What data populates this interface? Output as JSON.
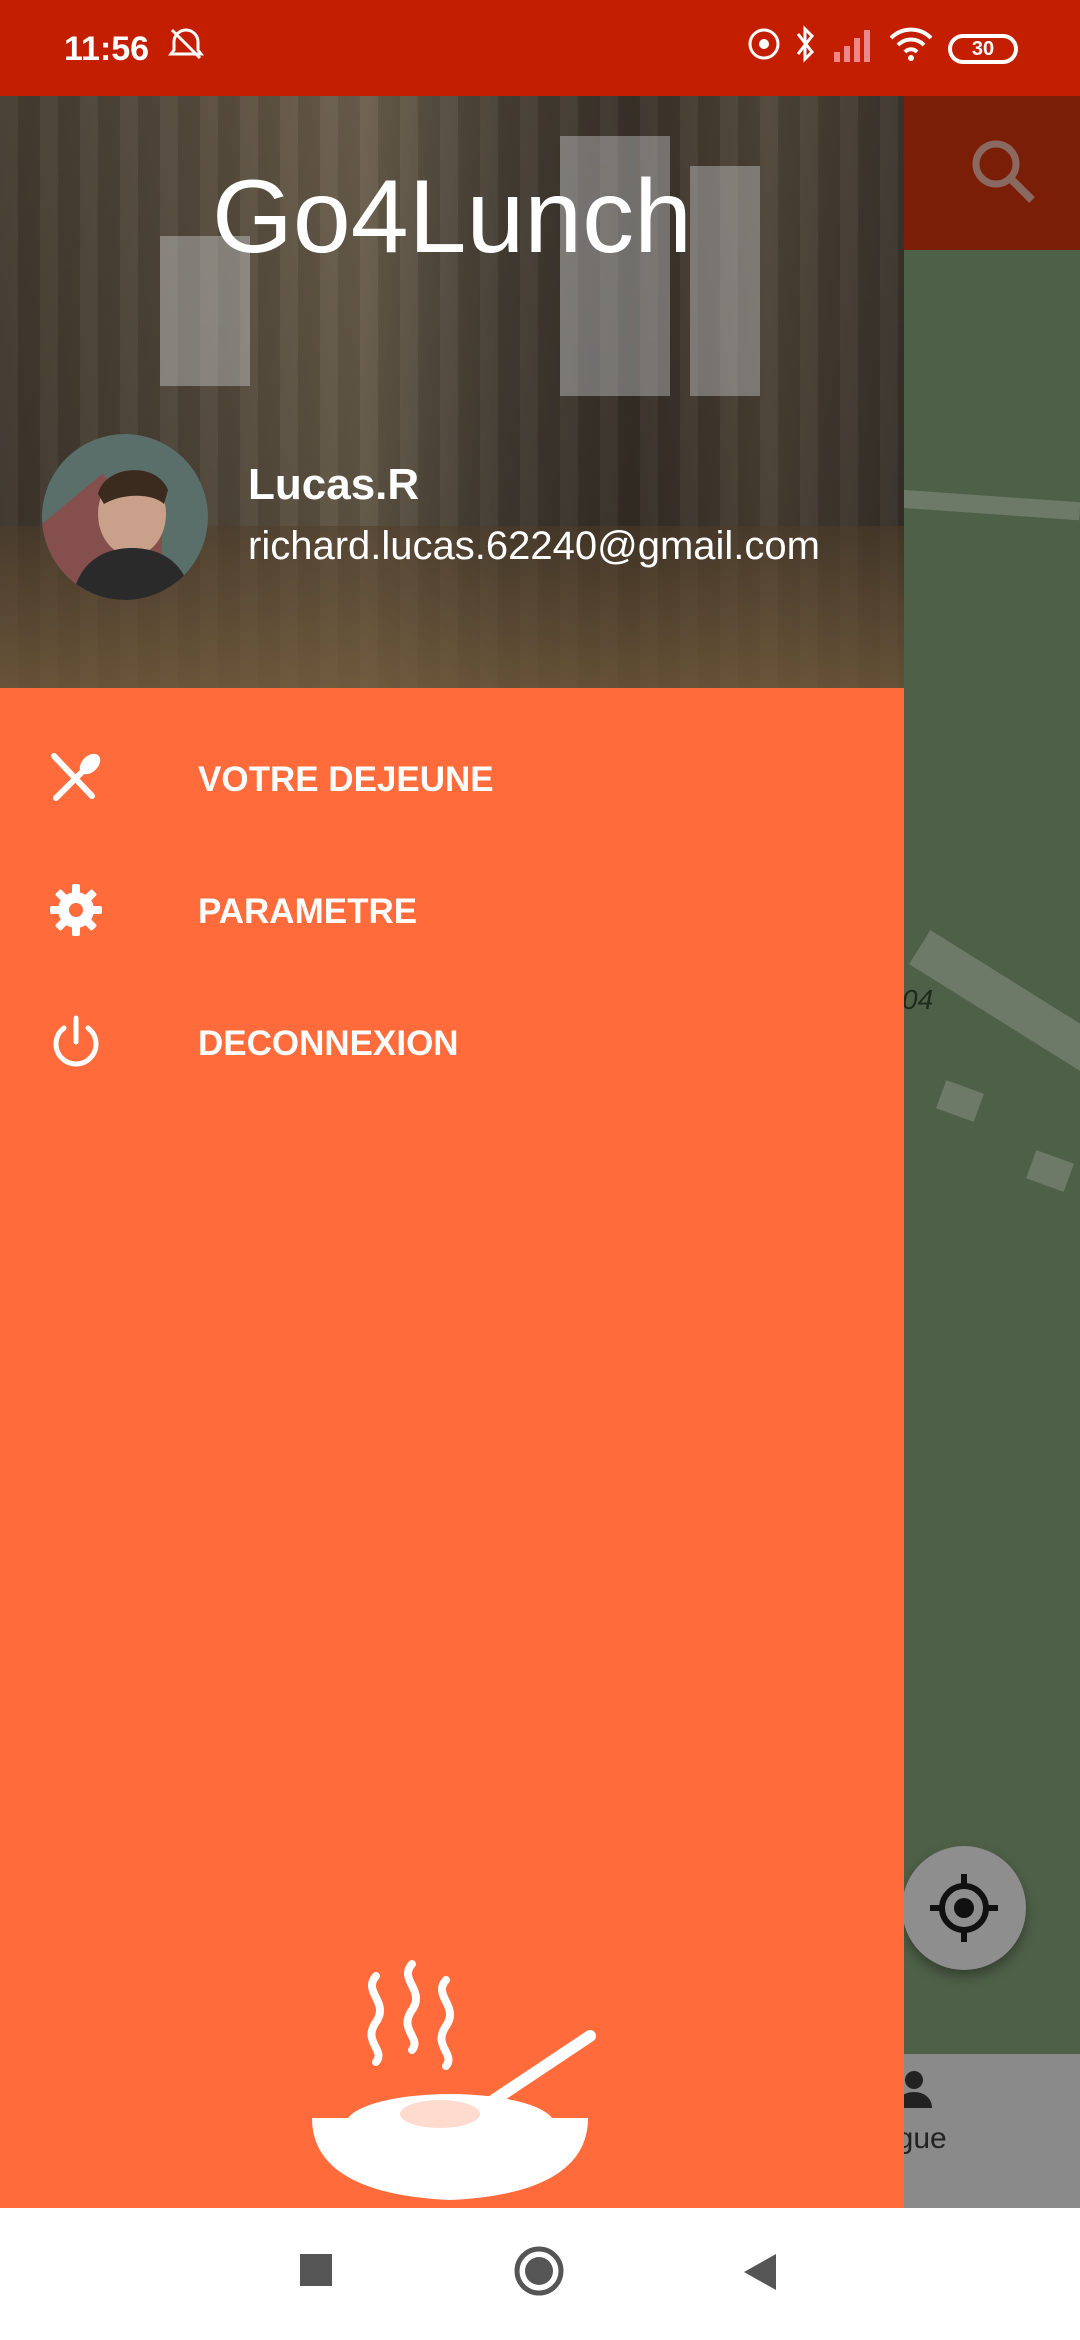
{
  "status_bar": {
    "time": "11:56",
    "battery": "30"
  },
  "drawer": {
    "app_title": "Go4Lunch",
    "user": {
      "name": "Lucas.R",
      "email": "richard.lucas.62240@gmail.com"
    },
    "menu": [
      {
        "label": "VOTRE DEJEUNE",
        "icon": "fork-spoon-icon"
      },
      {
        "label": "PARAMETRE",
        "icon": "gear-icon"
      },
      {
        "label": "DECONNEXION",
        "icon": "power-icon"
      }
    ],
    "colors": {
      "drawer_bg": "#ff6b3a",
      "status_bar": "#c41e00"
    }
  },
  "background": {
    "map_label": "04",
    "bottom_nav_label": "egue"
  }
}
